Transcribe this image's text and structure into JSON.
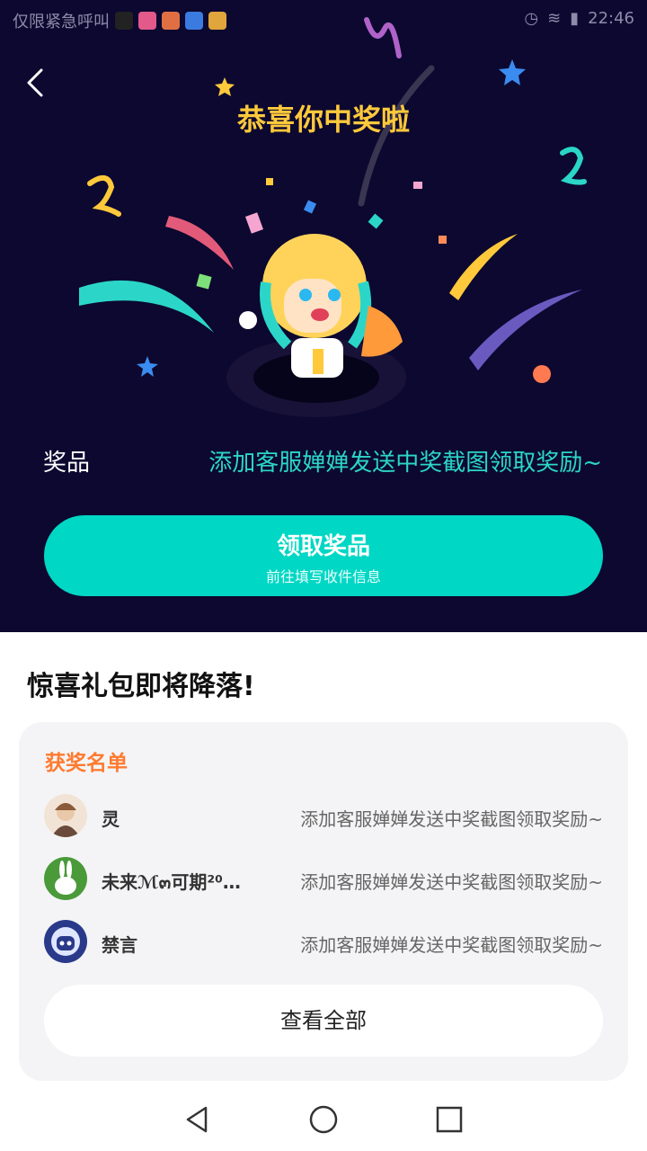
{
  "status_bar": {
    "left_text": "仅限紧急呼叫",
    "time": "22:46"
  },
  "header": {
    "title": "恭喜你中奖啦"
  },
  "prize": {
    "label": "奖品",
    "value": "添加客服婵婵发送中奖截图领取奖励~"
  },
  "claim_button": {
    "label": "领取奖品",
    "sublabel": "前往填写收件信息"
  },
  "section": {
    "title": "惊喜礼包即将降落!"
  },
  "winners": {
    "heading": "获奖名单",
    "rows": [
      {
        "name": "灵",
        "prize": "添加客服婵婵发送中奖截图领取奖励~"
      },
      {
        "name": "未来ℳ๓可期²⁰…",
        "prize": "添加客服婵婵发送中奖截图领取奖励~"
      },
      {
        "name": "禁言",
        "prize": "添加客服婵婵发送中奖截图领取奖励~"
      }
    ],
    "view_all": "查看全部"
  },
  "colors": {
    "hero_bg": "#0c0830",
    "accent": "#00d7c4",
    "title_yellow": "#ffc93b",
    "winner_heading": "#ff7a2f"
  },
  "icons": [
    "back-arrow-icon",
    "nav-back-icon",
    "nav-home-icon",
    "nav-recents-icon"
  ]
}
